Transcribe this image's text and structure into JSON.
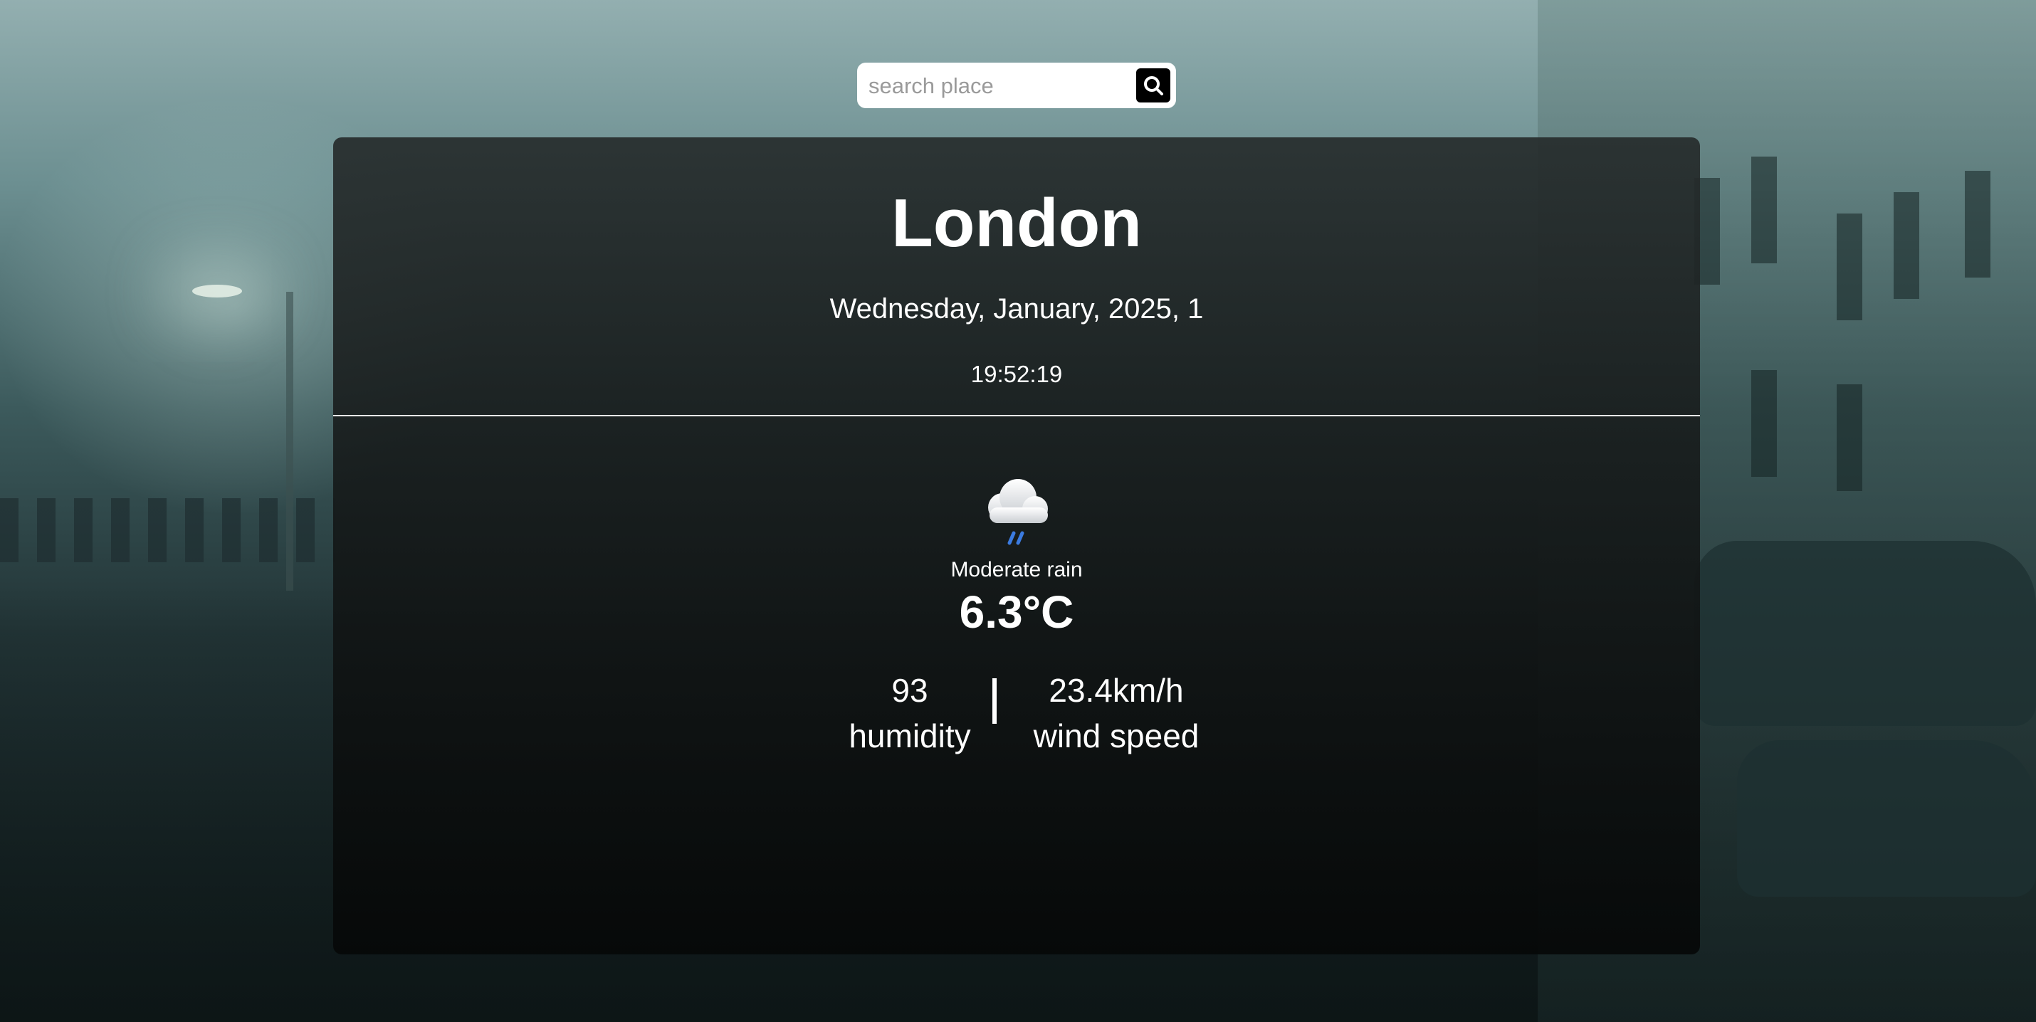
{
  "search": {
    "placeholder": "search place",
    "value": ""
  },
  "weather": {
    "city": "London",
    "date": "Wednesday, January, 2025, 1",
    "time": "19:52:19",
    "icon": "cloud-rain-icon",
    "condition": "Moderate rain",
    "temperature": "6.3°C",
    "humidity_value": "93",
    "humidity_label": "humidity",
    "wind_value": "23.4km/h",
    "wind_label": "wind speed"
  },
  "colors": {
    "card_background": "#1a1f1f",
    "text": "#ffffff",
    "search_button": "#000000",
    "rain_drops": "#3b7be0"
  }
}
